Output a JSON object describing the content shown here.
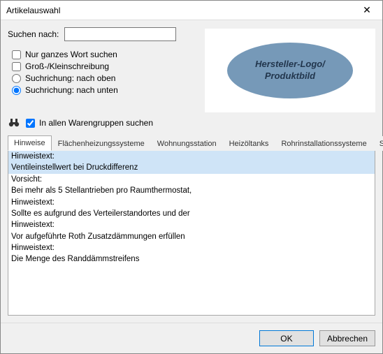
{
  "window": {
    "title": "Artikelauswahl"
  },
  "search": {
    "label": "Suchen nach:",
    "value": ""
  },
  "options": {
    "whole_word": "Nur ganzes Wort suchen",
    "case_sensitive": "Groß-/Kleinschreibung",
    "dir_up": "Suchrichung: nach oben",
    "dir_down": "Suchrichung: nach unten",
    "all_groups": "In allen Warengruppen suchen"
  },
  "logo": {
    "line1": "Hersteller-Logo/",
    "line2": "Produktbild"
  },
  "tabs": [
    "Hinweise",
    "Flächenheizungssysteme",
    "Wohnungsstation",
    "Heizöltanks",
    "Rohrinstallationssysteme",
    "Sola"
  ],
  "active_tab_index": 0,
  "rows": [
    {
      "text": "Hinweistext:",
      "selected": true
    },
    {
      "text": "Ventileinstellwert bei Druckdifferenz",
      "selected": true
    },
    {
      "text": "Vorsicht:",
      "selected": false
    },
    {
      "text": "Bei mehr als 5 Stellantrieben pro Raumthermostat,",
      "selected": false
    },
    {
      "text": "Hinweistext:",
      "selected": false
    },
    {
      "text": "Sollte es aufgrund des Verteilerstandortes und der",
      "selected": false
    },
    {
      "text": "Hinweistext:",
      "selected": false
    },
    {
      "text": "Vor aufgeführte Roth Zusatzdämmungen erfüllen",
      "selected": false
    },
    {
      "text": "Hinweistext:",
      "selected": false
    },
    {
      "text": "Die Menge des Randdämmstreifens",
      "selected": false
    }
  ],
  "buttons": {
    "ok": "OK",
    "cancel": "Abbrechen"
  }
}
